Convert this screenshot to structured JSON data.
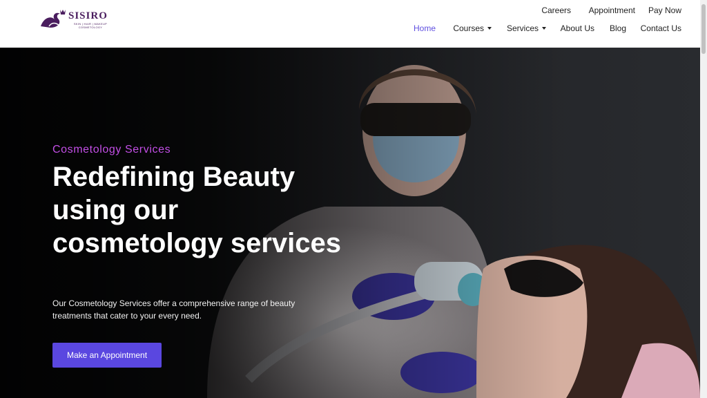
{
  "brand": {
    "name": "SISIRO",
    "tagline": "SKIN | HAIR | MAKEUP COSMETOLOGY",
    "color": "#4a1d5e"
  },
  "top_nav": [
    "Careers",
    "Appointment",
    "Pay Now"
  ],
  "main_nav": [
    {
      "label": "Home",
      "active": true
    },
    {
      "label": "Courses",
      "dropdown": true
    },
    {
      "label": "Services",
      "dropdown": true
    },
    {
      "label": "About Us"
    },
    {
      "label": "Blog"
    },
    {
      "label": "Contact Us"
    }
  ],
  "hero": {
    "eyebrow": "Cosmetology Services",
    "headline": "Redefining Beauty using our cosmetology services",
    "description": "Our Cosmetology Services offer a comprehensive range of beauty treatments that cater to your every need.",
    "cta_label": "Make an Appointment",
    "image_alt": "cosmetologist-treating-patient-photo"
  },
  "colors": {
    "accent": "#5a47e0",
    "nav_active": "#5f4fe0",
    "eyebrow": "#c34fe6"
  }
}
